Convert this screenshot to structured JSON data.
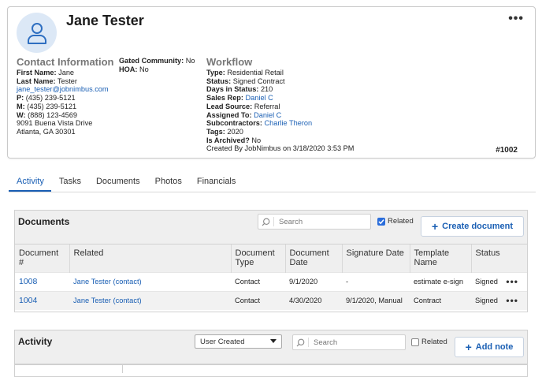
{
  "contact": {
    "name": "Jane Tester",
    "more_label": "•••",
    "info_title": "Contact Information",
    "first_name_label": "First Name:",
    "first_name": "Jane",
    "last_name_label": "Last Name:",
    "last_name": "Tester",
    "email": "jane_tester@jobnimbus.com",
    "phone_p_label": "P:",
    "phone_p": "(435) 239-5121",
    "phone_m_label": "M:",
    "phone_m": "(435) 239-5121",
    "phone_w_label": "W:",
    "phone_w": "(888) 123-4569",
    "address1": "9091 Buena Vista Drive",
    "address2": "Atlanta, GA 30301",
    "gated_label": "Gated Community:",
    "gated_value": "No",
    "hoa_label": "HOA:",
    "hoa_value": "No",
    "workflow_title": "Workflow",
    "type_label": "Type:",
    "type_value": "Residential Retail",
    "status_label": "Status:",
    "status_value": "Signed Contract",
    "days_label": "Days in Status:",
    "days_value": "210",
    "sales_rep_label": "Sales Rep:",
    "sales_rep_value": "Daniel C",
    "lead_source_label": "Lead Source:",
    "lead_source_value": "Referral",
    "assigned_label": "Assigned To:",
    "assigned_value": "Daniel C",
    "subcontractors_label": "Subcontractors:",
    "subcontractors_value": "Charlie Theron",
    "tags_label": "Tags:",
    "tags_value": "2020",
    "archived_label": "Is Archived?",
    "archived_value": "No",
    "created_by": "Created By JobNimbus on 3/18/2020 3:53 PM",
    "job_number": "#1002"
  },
  "tabs": [
    {
      "label": "Activity"
    },
    {
      "label": "Tasks"
    },
    {
      "label": "Documents"
    },
    {
      "label": "Photos"
    },
    {
      "label": "Financials"
    }
  ],
  "documents": {
    "title": "Documents",
    "search_placeholder": "Search",
    "related_label": "Related",
    "related_checked": true,
    "create_button": "Create document",
    "headers": {
      "num": "Document #",
      "related": "Related",
      "type": "Document Type",
      "date": "Document Date",
      "sig": "Signature Date",
      "template": "Template Name",
      "status": "Status"
    },
    "rows": [
      {
        "num": "1008",
        "related": "Jane Tester (contact)",
        "type": "Contact",
        "date": "9/1/2020",
        "sig": "-",
        "template": "estimate e-sign",
        "status": "Signed"
      },
      {
        "num": "1004",
        "related": "Jane Tester (contact)",
        "type": "Contact",
        "date": "4/30/2020",
        "sig": "9/1/2020, Manual",
        "template": "Contract",
        "status": "Signed"
      }
    ],
    "row_more": "•••"
  },
  "activity": {
    "title": "Activity",
    "filter_value": "User Created",
    "search_placeholder": "Search",
    "related_label": "Related",
    "related_checked": false,
    "add_button": "Add note"
  },
  "colors": {
    "accent": "#1a5fb4",
    "avatar_bg": "#dce8f6",
    "panel_bg": "#efefef"
  },
  "icons": {
    "avatar": "person-icon",
    "search": "search-icon",
    "plus": "plus-icon",
    "dropdown": "caret-down-icon",
    "check": "check-icon"
  }
}
